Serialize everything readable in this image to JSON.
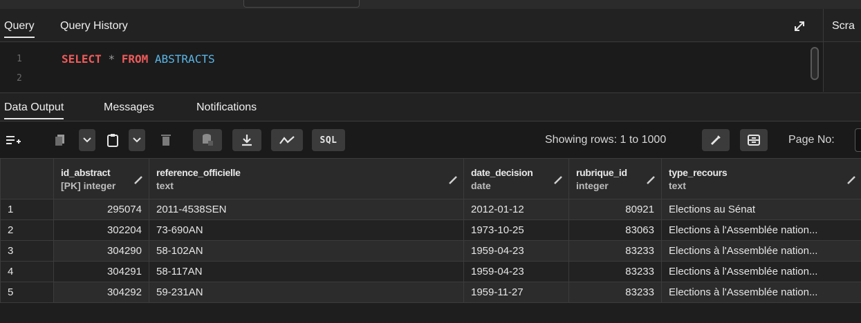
{
  "query_panel": {
    "tabs": [
      {
        "label": "Query"
      },
      {
        "label": "Query History"
      }
    ],
    "scratch_label": "Scra",
    "line_numbers": [
      "1",
      "2"
    ],
    "sql": {
      "kw1": "SELECT",
      "op": "*",
      "kw2": "FROM",
      "ident": "ABSTRACTS"
    }
  },
  "output_tabs": [
    {
      "label": "Data Output"
    },
    {
      "label": "Messages"
    },
    {
      "label": "Notifications"
    }
  ],
  "toolbar": {
    "sql_label": "SQL",
    "showing_rows": "Showing rows: 1 to 1000",
    "page_no_label": "Page No:"
  },
  "grid": {
    "columns": [
      {
        "name": "id_abstract",
        "type": "[PK] integer"
      },
      {
        "name": "reference_officielle",
        "type": "text"
      },
      {
        "name": "date_decision",
        "type": "date"
      },
      {
        "name": "rubrique_id",
        "type": "integer"
      },
      {
        "name": "type_recours",
        "type": "text"
      }
    ],
    "rows": [
      {
        "n": "1",
        "id": "295074",
        "ref": "2011-4538SEN",
        "date": "2012-01-12",
        "rubrique": "80921",
        "type": "Elections au Sénat"
      },
      {
        "n": "2",
        "id": "302204",
        "ref": "73-690AN",
        "date": "1973-10-25",
        "rubrique": "83063",
        "type": "Elections à l'Assemblée nation..."
      },
      {
        "n": "3",
        "id": "304290",
        "ref": "58-102AN",
        "date": "1959-04-23",
        "rubrique": "83233",
        "type": "Elections à l'Assemblée nation..."
      },
      {
        "n": "4",
        "id": "304291",
        "ref": "58-117AN",
        "date": "1959-04-23",
        "rubrique": "83233",
        "type": "Elections à l'Assemblée nation..."
      },
      {
        "n": "5",
        "id": "304292",
        "ref": "59-231AN",
        "date": "1959-11-27",
        "rubrique": "83233",
        "type": "Elections à l'Assemblée nation..."
      }
    ]
  }
}
